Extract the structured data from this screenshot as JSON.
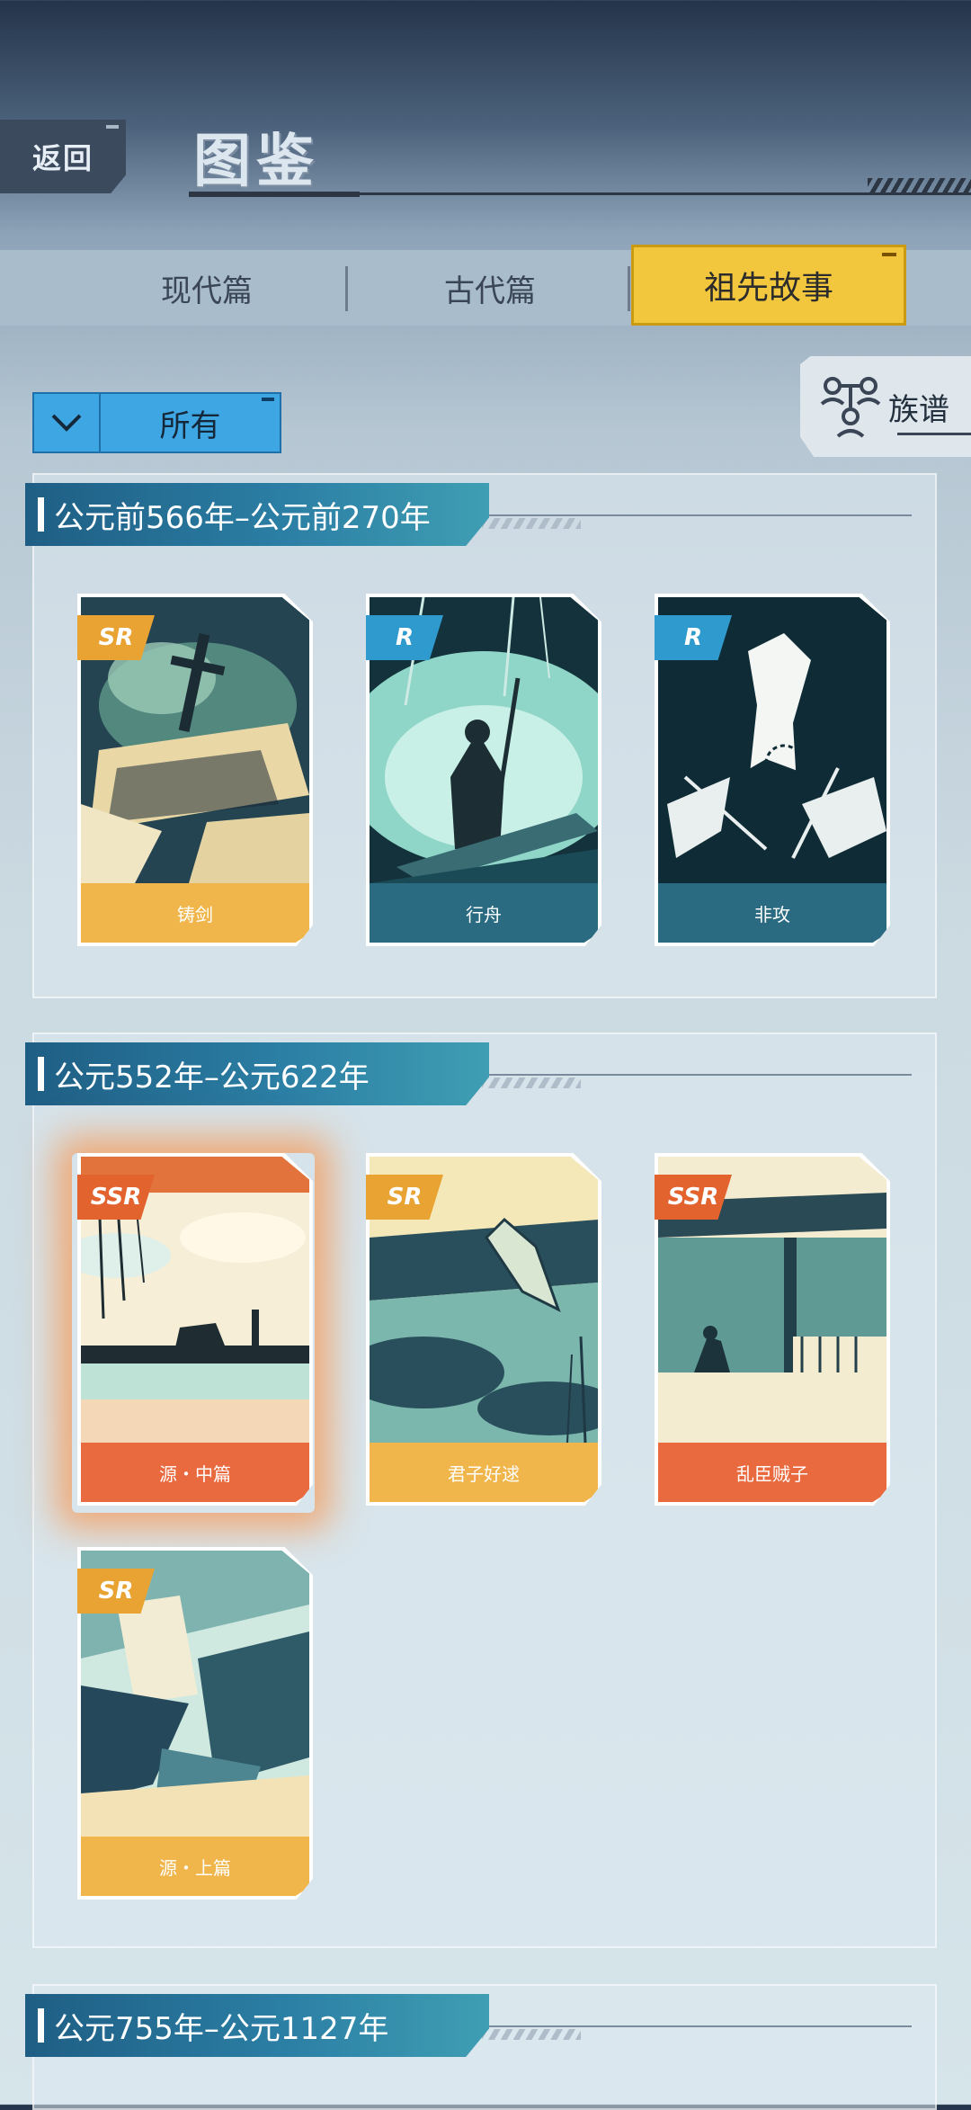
{
  "header": {
    "back_label": "返回",
    "title": "图鉴"
  },
  "tabs": [
    {
      "label": "现代篇",
      "active": false
    },
    {
      "label": "古代篇",
      "active": false
    },
    {
      "label": "祖先故事",
      "active": true
    }
  ],
  "filter": {
    "selected": "所有"
  },
  "family_tree": {
    "label": "族谱",
    "icon": "family-tree-icon"
  },
  "sections": [
    {
      "era": "公元前566年–公元前270年",
      "cards": [
        {
          "title": "铸剑",
          "rarity": "SR"
        },
        {
          "title": "行舟",
          "rarity": "R"
        },
        {
          "title": "非攻",
          "rarity": "R"
        }
      ]
    },
    {
      "era": "公元552年–公元622年",
      "cards": [
        {
          "title": "源・中篇",
          "rarity": "SSR"
        },
        {
          "title": "君子好逑",
          "rarity": "SR"
        },
        {
          "title": "乱臣贼子",
          "rarity": "SSR"
        },
        {
          "title": "源・上篇",
          "rarity": "SR"
        }
      ]
    },
    {
      "era": "公元755年–公元1127年",
      "cards": []
    }
  ],
  "colors": {
    "accent_tab": "#f3c73d",
    "filter": "#3fa6e4",
    "sr": "#f0b64b",
    "r": "#2a6b82",
    "ssr": "#e96a3f"
  }
}
